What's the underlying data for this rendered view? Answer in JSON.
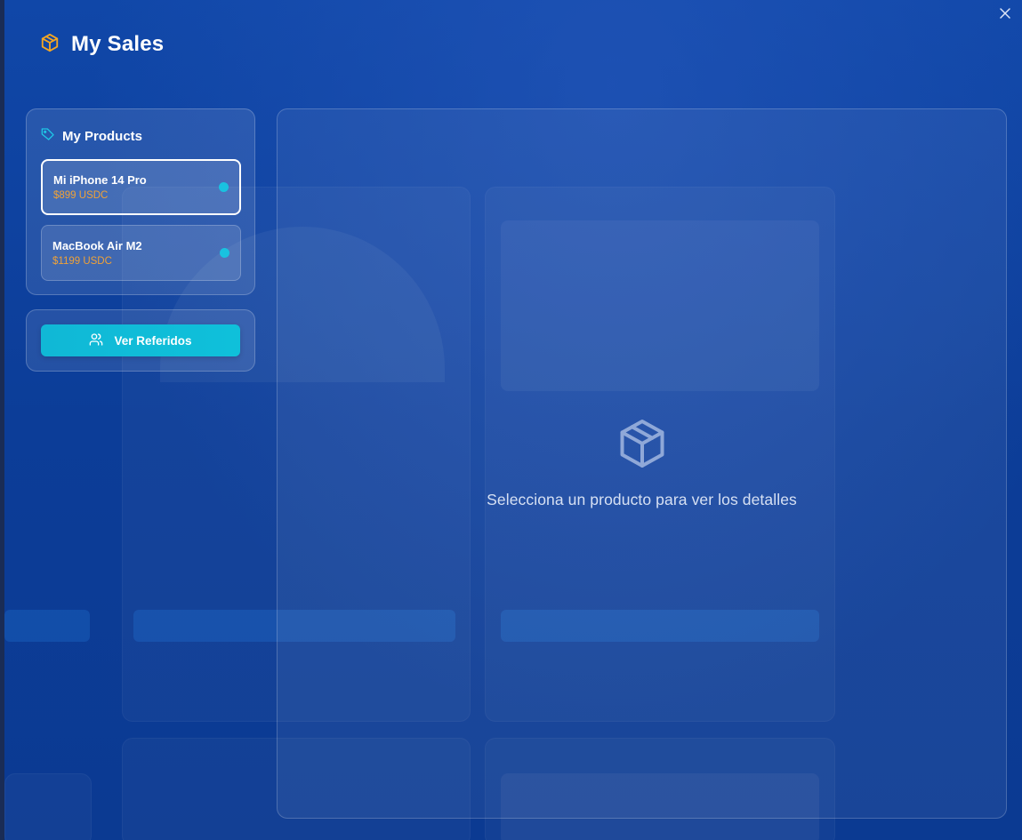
{
  "modal": {
    "title": "My Sales",
    "close_label": "×",
    "icon": "package-icon"
  },
  "products_panel": {
    "heading": "My Products",
    "heading_icon": "tag-icon",
    "items": [
      {
        "name": "Mi iPhone 14 Pro",
        "price": "$899 USDC",
        "selected": true
      },
      {
        "name": "MacBook Air M2",
        "price": "$1199 USDC",
        "selected": false
      }
    ]
  },
  "referrals": {
    "button_label": "Ver Referidos",
    "icon": "users-icon"
  },
  "details": {
    "empty_icon": "package-icon",
    "empty_message": "Selecciona un producto para ver los detalles"
  },
  "colors": {
    "background": "#0d3f9a",
    "accent_cyan": "#10b8d6",
    "price_orange": "#f0a237",
    "icon_orange": "#f5a623",
    "status_dot": "#19c2e0"
  }
}
